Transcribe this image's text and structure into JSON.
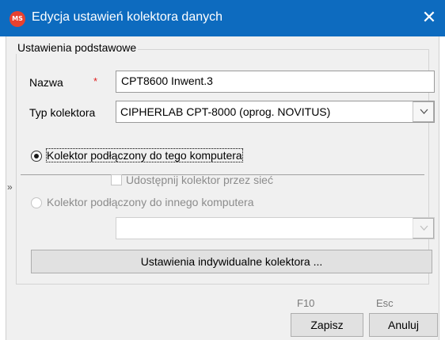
{
  "window": {
    "title": "Edycja ustawień kolektora danych",
    "icon_text": "MS",
    "close_glyph": "✕",
    "accent": "#0d6bbf"
  },
  "group": {
    "title": "Ustawienia podstawowe"
  },
  "fields": {
    "name_label": "Nazwa",
    "required_mark": "*",
    "name_value": "CPT8600 Inwent.3",
    "type_label": "Typ kolektora",
    "type_value": "CIPHERLAB CPT-8000 (oprog. NOVITUS)"
  },
  "options": {
    "marker": "»",
    "local_label": "Kolektor podłączony do tego komputera",
    "local_checked": true,
    "share_label": "Udostępnij kolektor przez sieć",
    "share_checked": false,
    "remote_label": "Kolektor podłączony do innego komputera",
    "remote_checked": false,
    "remote_value": ""
  },
  "buttons": {
    "individual_label": "Ustawienia indywidualne kolektora ...",
    "save_hint": "F10",
    "save_label": "Zapisz",
    "cancel_hint": "Esc",
    "cancel_label": "Anuluj"
  },
  "icons": {
    "chevron": "chevron-down-icon",
    "close": "close-icon"
  }
}
